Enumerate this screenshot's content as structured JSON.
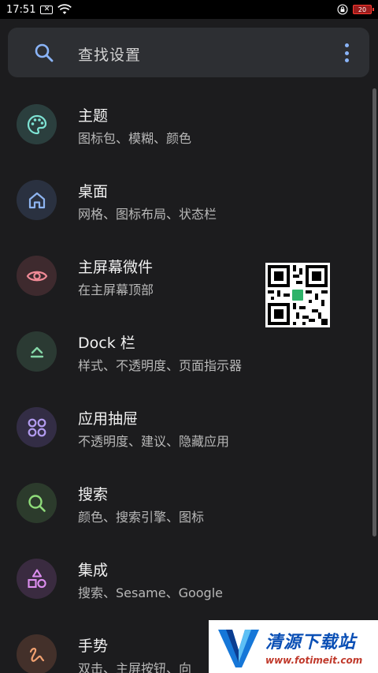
{
  "status_bar": {
    "time": "17:51",
    "notif_badge": "✕",
    "battery": "20"
  },
  "search": {
    "placeholder": "查找设置"
  },
  "items": [
    {
      "title": "主题",
      "subtitle": "图标包、模糊、颜色",
      "icon": "palette-icon",
      "bg": "#2b3f3e",
      "fg": "#7ee3d4"
    },
    {
      "title": "桌面",
      "subtitle": "网格、图标布局、状态栏",
      "icon": "home-icon",
      "bg": "#2a3140",
      "fg": "#8eb4f0"
    },
    {
      "title": "主屏幕微件",
      "subtitle": "在主屏幕顶部",
      "icon": "eye-icon",
      "bg": "#3e2a2e",
      "fg": "#f08a96"
    },
    {
      "title": "Dock 栏",
      "subtitle": "样式、不透明度、页面指示器",
      "icon": "dock-icon",
      "bg": "#2b3a33",
      "fg": "#86d7a8"
    },
    {
      "title": "应用抽屉",
      "subtitle": "不透明度、建议、隐藏应用",
      "icon": "apps-grid-icon",
      "bg": "#332d45",
      "fg": "#b39cf0"
    },
    {
      "title": "搜索",
      "subtitle": "颜色、搜索引擎、图标",
      "icon": "search-icon",
      "bg": "#2c3b2c",
      "fg": "#8fdc7a"
    },
    {
      "title": "集成",
      "subtitle": "搜索、Sesame、Google",
      "icon": "shapes-icon",
      "bg": "#3a2b40",
      "fg": "#dd8ef0"
    },
    {
      "title": "手势",
      "subtitle": "双击、主屏按钮、向",
      "icon": "gesture-icon",
      "bg": "#43302a",
      "fg": "#f0a070"
    }
  ],
  "watermark": {
    "title": "清源下载站",
    "url": "www.fotimeit.com"
  }
}
